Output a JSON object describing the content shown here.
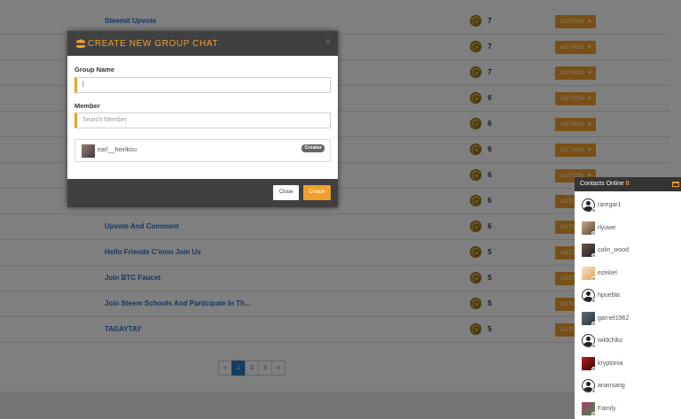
{
  "posts": [
    {
      "title": "Steemit Upvote",
      "count": "7",
      "action": "ACTION"
    },
    {
      "title": "",
      "count": "7",
      "action": "ACTION"
    },
    {
      "title": "",
      "count": "7",
      "action": "ACTION"
    },
    {
      "title": "",
      "count": "6",
      "action": "ACTION"
    },
    {
      "title": "",
      "count": "6",
      "action": "ACTION"
    },
    {
      "title": "",
      "count": "6",
      "action": "ACTION"
    },
    {
      "title": "",
      "count": "6",
      "action": "ACTION"
    },
    {
      "title": "",
      "count": "6",
      "action": "ACTION"
    },
    {
      "title": "Upvote And Comment",
      "count": "6",
      "action": "ACTION"
    },
    {
      "title": "Hello Friends C'mon Join Us",
      "count": "5",
      "action": "ACTION"
    },
    {
      "title": "Join BTC Faucet",
      "count": "5",
      "action": "ACTION"
    },
    {
      "title": "Join Steem Schools And Participate In Th...",
      "count": "5",
      "action": "ACTION"
    },
    {
      "title": "TAGAYTAY",
      "count": "5",
      "action": "ACTION"
    }
  ],
  "pagination": {
    "prev": "«",
    "pages": [
      "1",
      "2",
      "3"
    ],
    "current": "1",
    "next": "»"
  },
  "modal": {
    "title": "CREATE NEW GROUP CHAT",
    "close_icon": "×",
    "group_name_label": "Group Name",
    "group_name_value": "|",
    "member_label": "Member",
    "member_placeholder": "Search Member",
    "member": {
      "name": "earl__heirikou",
      "badge": "Creator"
    },
    "close_label": "Close",
    "create_label": "Create"
  },
  "contacts": {
    "title": "Contacts Online",
    "online_count": "0",
    "items": [
      {
        "name": "raregar1",
        "avatar": "default"
      },
      {
        "name": "rlyuwe",
        "avatar": "photo"
      },
      {
        "name": "colin_wood",
        "avatar": "photo"
      },
      {
        "name": "ezekiel",
        "avatar": "photo"
      },
      {
        "name": "hpuebla",
        "avatar": "default"
      },
      {
        "name": "garnet1962",
        "avatar": "photo"
      },
      {
        "name": "wildchikz",
        "avatar": "default"
      },
      {
        "name": "kryptonia",
        "avatar": "logo"
      },
      {
        "name": "anansang",
        "avatar": "default"
      },
      {
        "name": "Family",
        "avatar": "photo"
      }
    ]
  },
  "colors": {
    "accent": "#f0a02c",
    "link": "#2a6fc9",
    "header": "#404040"
  }
}
